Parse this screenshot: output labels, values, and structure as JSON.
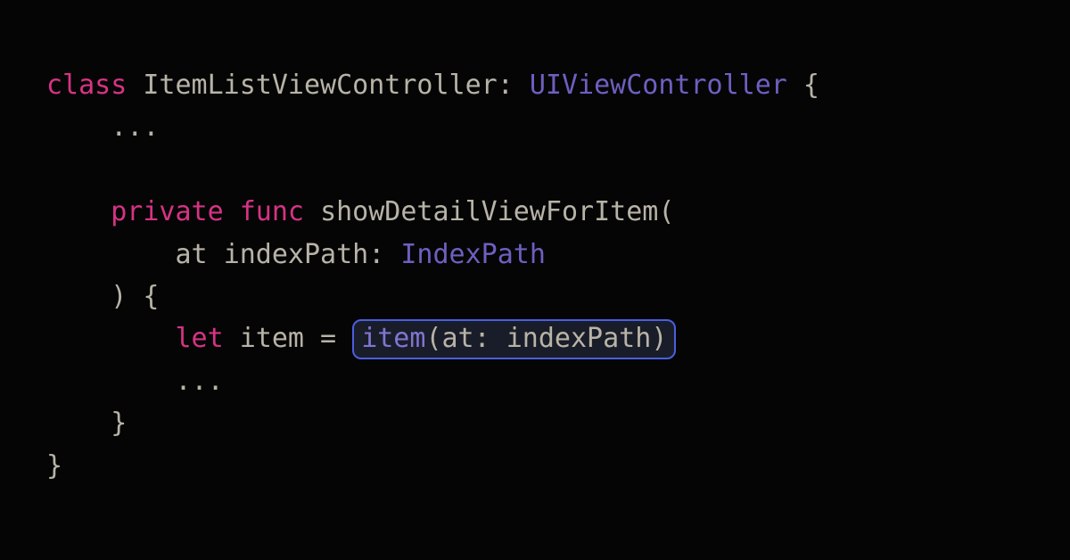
{
  "code": {
    "kw_class": "class",
    "class_name": "ItemListViewController",
    "colon_space": ": ",
    "superclass": "UIViewController",
    "open_brace": " {",
    "ellipsis1": "    ...",
    "kw_private": "private",
    "kw_func": "func",
    "func_name": "showDetailViewForItem",
    "open_paren": "(",
    "param_label": "at",
    "param_name": "indexPath",
    "param_type": "IndexPath",
    "close_paren_brace": ") {",
    "kw_let": "let",
    "var_item": "item",
    "equals": " = ",
    "call_name": "item",
    "call_open": "(",
    "call_arg_label": "at",
    "call_arg_colon": ": ",
    "call_arg_name": "indexPath",
    "call_close": ")",
    "ellipsis2": "        ...",
    "close_inner": "    }",
    "close_outer": "}"
  },
  "colors": {
    "background": "#050505",
    "keyword_pink": "#d63384",
    "type_purple": "#6c60c0",
    "text_default": "#b8b3a7",
    "call_purple": "#8075d1",
    "highlight_border": "#4b5ee0",
    "highlight_bg": "#191d29"
  }
}
